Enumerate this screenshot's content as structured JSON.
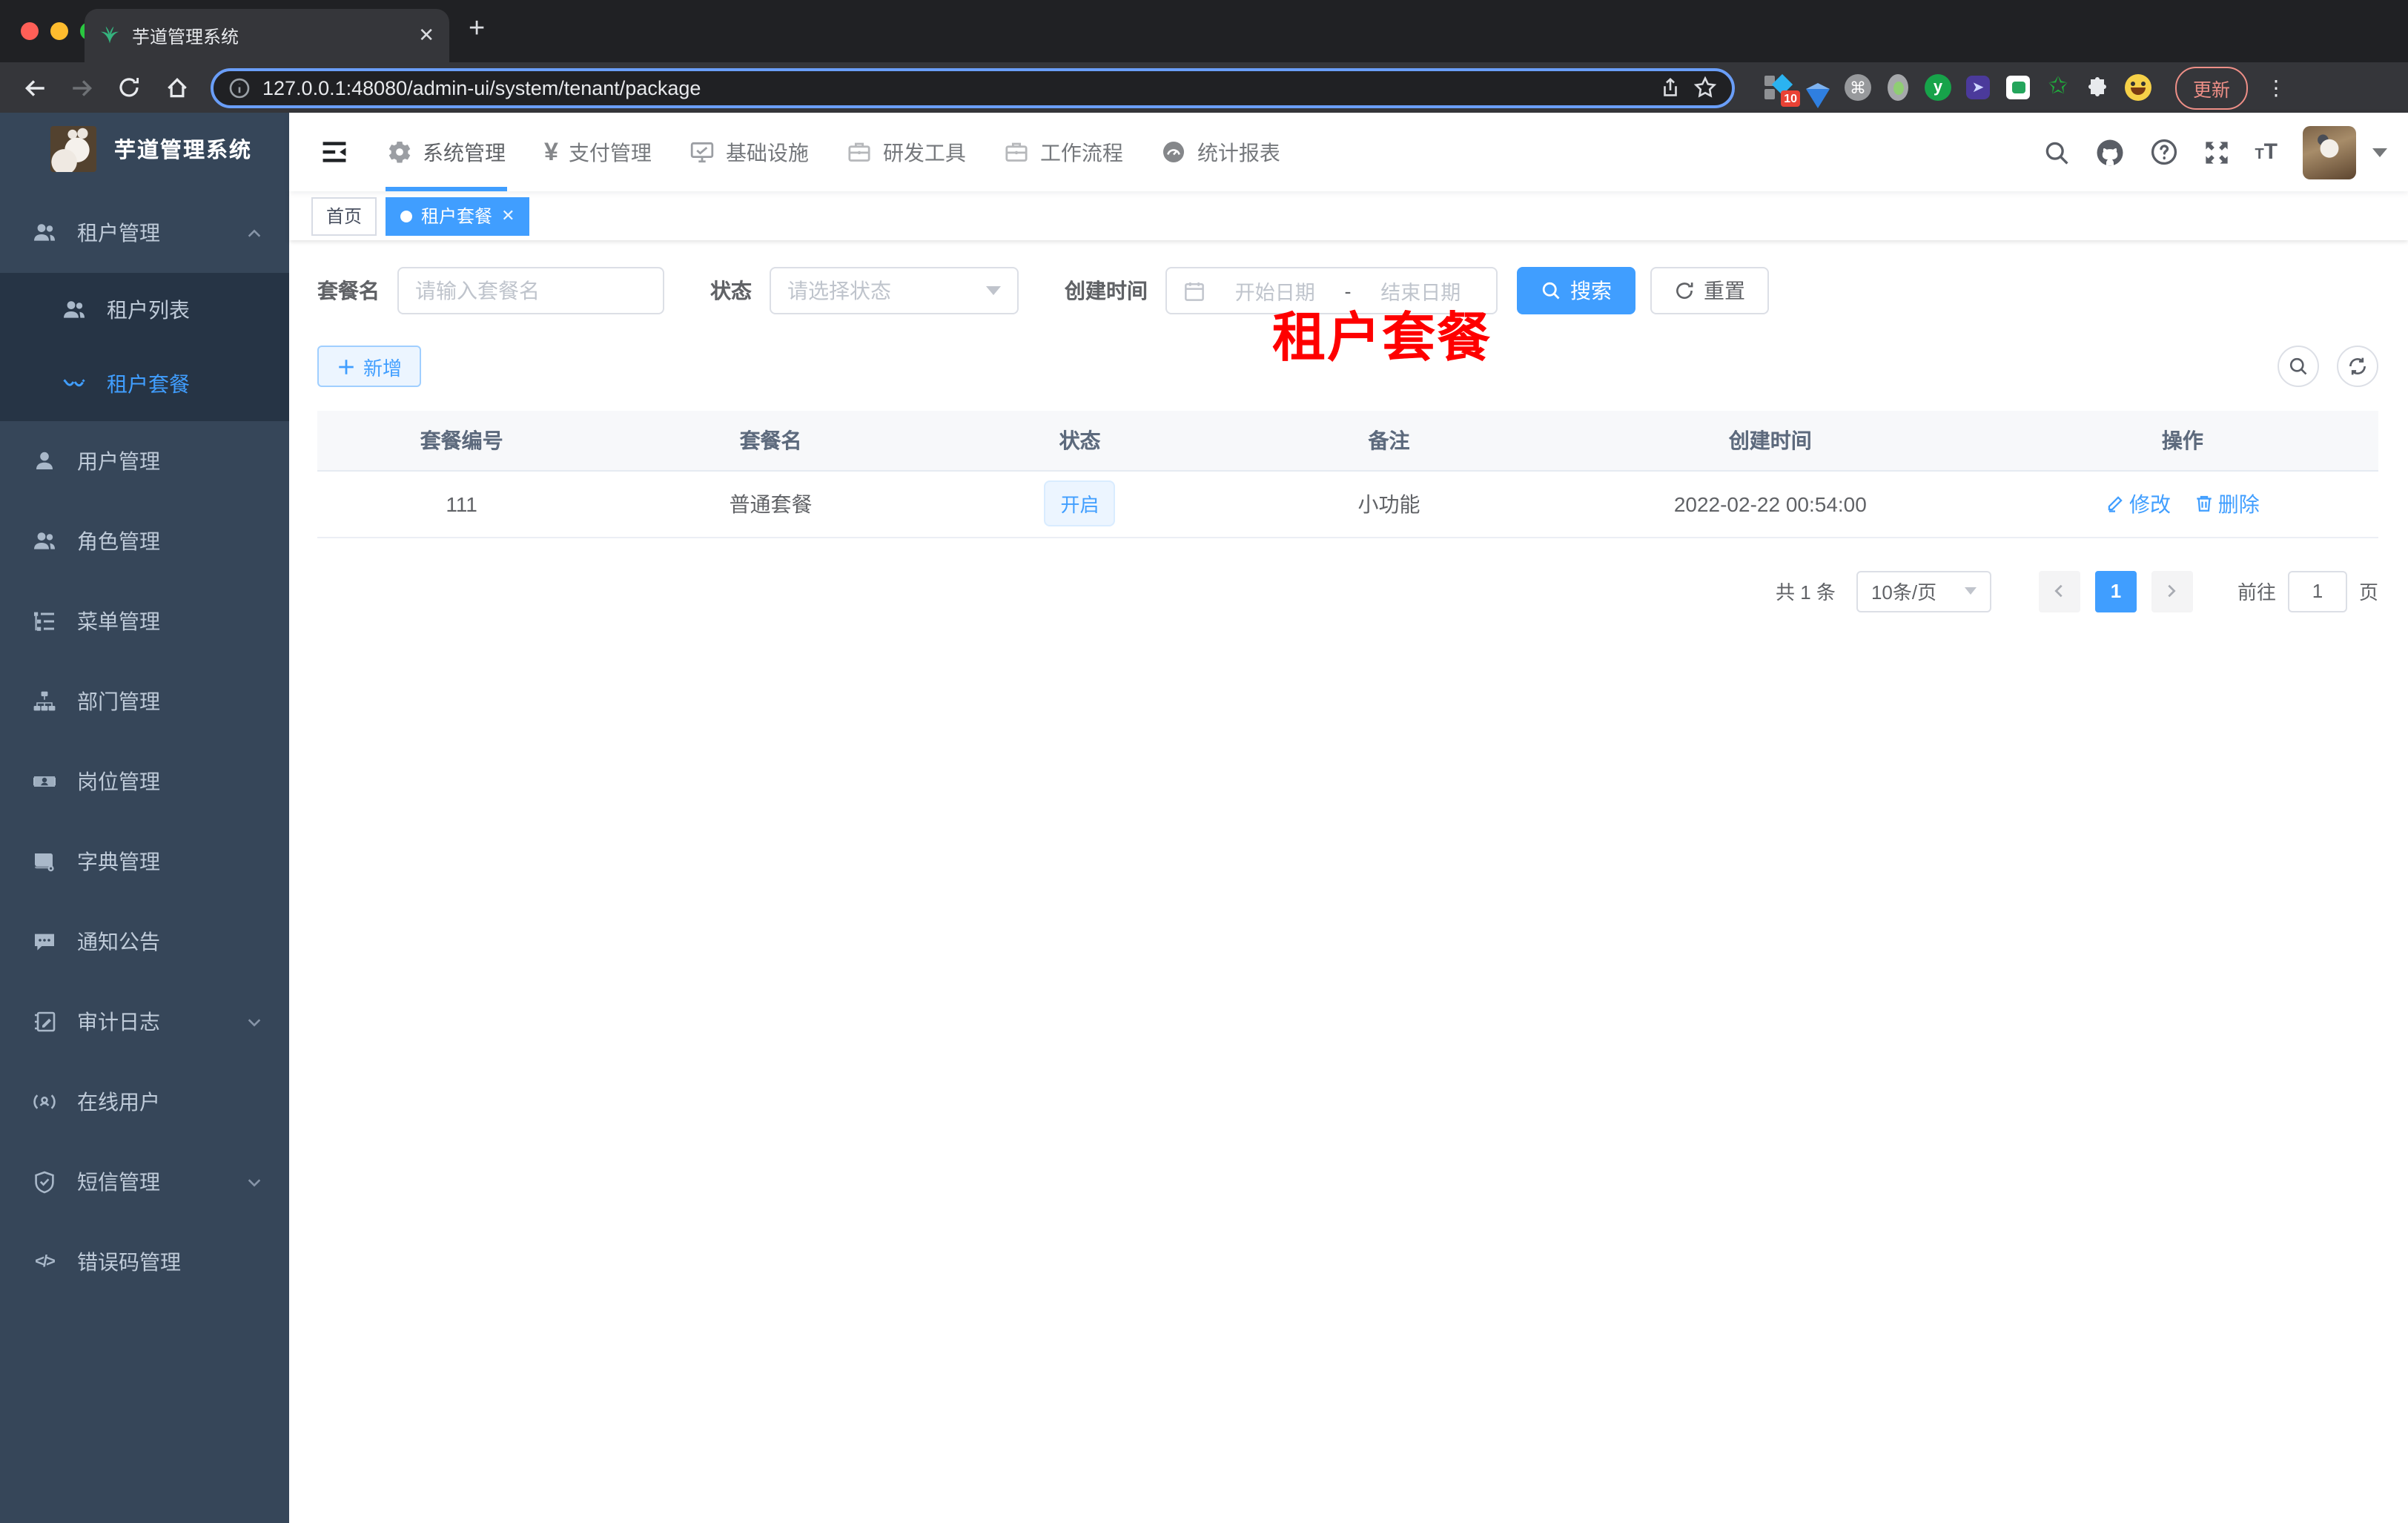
{
  "browser": {
    "tab_title": "芋道管理系统",
    "url": "127.0.0.1:48080/admin-ui/system/tenant/package",
    "update_label": "更新",
    "extension_badge": "10"
  },
  "topnav": {
    "items": [
      {
        "label": "系统管理",
        "icon": "gear-icon",
        "active": true
      },
      {
        "label": "支付管理",
        "icon": "yen-icon"
      },
      {
        "label": "基础设施",
        "icon": "monitor-icon"
      },
      {
        "label": "研发工具",
        "icon": "briefcase-icon"
      },
      {
        "label": "工作流程",
        "icon": "briefcase-icon"
      },
      {
        "label": "统计报表",
        "icon": "dashboard-icon"
      }
    ]
  },
  "sidebar": {
    "title": "芋道管理系统",
    "items": [
      {
        "label": "租户管理"
      },
      {
        "label": "租户列表"
      },
      {
        "label": "租户套餐",
        "active": true
      },
      {
        "label": "用户管理"
      },
      {
        "label": "角色管理"
      },
      {
        "label": "菜单管理"
      },
      {
        "label": "部门管理"
      },
      {
        "label": "岗位管理"
      },
      {
        "label": "字典管理"
      },
      {
        "label": "通知公告"
      },
      {
        "label": "审计日志"
      },
      {
        "label": "在线用户"
      },
      {
        "label": "短信管理"
      },
      {
        "label": "错误码管理"
      }
    ]
  },
  "tags": {
    "items": [
      {
        "label": "首页"
      },
      {
        "label": "租户套餐",
        "active": true
      }
    ]
  },
  "annotation": {
    "text": "租户套餐",
    "color": "#fe0000"
  },
  "filters": {
    "name_label": "套餐名",
    "name_placeholder": "请输入套餐名",
    "status_label": "状态",
    "status_placeholder": "请选择状态",
    "time_label": "创建时间",
    "start_placeholder": "开始日期",
    "separator": "-",
    "end_placeholder": "结束日期",
    "search_label": "搜索",
    "reset_label": "重置"
  },
  "toolbar": {
    "add_label": "新增"
  },
  "table": {
    "columns": [
      "套餐编号",
      "套餐名",
      "状态",
      "备注",
      "创建时间",
      "操作"
    ],
    "row": {
      "id": "111",
      "name": "普通套餐",
      "status": "开启",
      "remark": "小功能",
      "created": "2022-02-22 00:54:00",
      "edit_label": "修改",
      "delete_label": "删除"
    }
  },
  "pagination": {
    "total": "共 1 条",
    "size": "10条/页",
    "page": "1",
    "goto": "前往",
    "goto_value": "1",
    "unit": "页"
  },
  "colors": {
    "accent": "#409eff",
    "sidebar_bg": "#364659",
    "submenu_bg": "#263445",
    "annotation_red": "#fe0000"
  }
}
